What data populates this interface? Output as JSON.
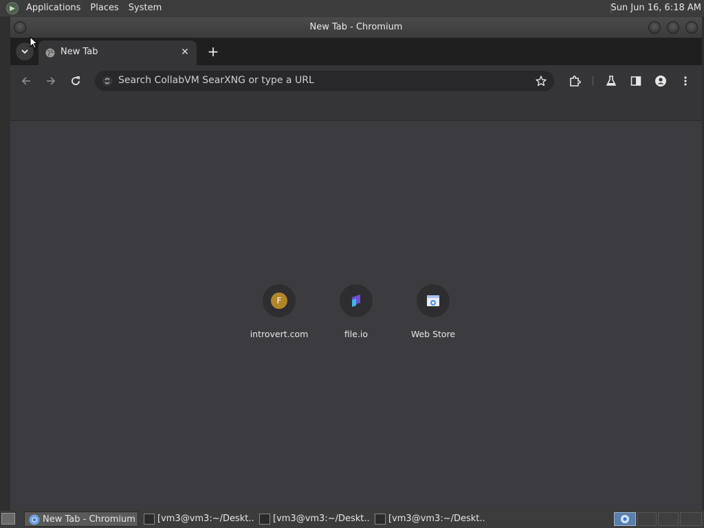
{
  "top_panel": {
    "menus": [
      "Applications",
      "Places",
      "System"
    ],
    "clock": "Sun Jun 16,  6:18 AM"
  },
  "window": {
    "title": "New Tab - Chromium"
  },
  "tabs": [
    {
      "label": "New Tab",
      "active": true
    }
  ],
  "toolbar": {
    "omnibox_placeholder": "Search CollabVM SearXNG or type a URL"
  },
  "shortcuts": [
    {
      "label": "introvert.com",
      "icon": "letter-f-favicon",
      "letter": "F"
    },
    {
      "label": "file.io",
      "icon": "fileio-favicon"
    },
    {
      "label": "Web Store",
      "icon": "webstore-favicon"
    }
  ],
  "taskbar": {
    "items": [
      {
        "label": "New Tab - Chromium",
        "active": true,
        "icon": "chromium-icon"
      },
      {
        "label": "[vm3@vm3:~/Deskt...",
        "active": false,
        "icon": "terminal-icon"
      },
      {
        "label": "[vm3@vm3:~/Deskt...",
        "active": false,
        "icon": "terminal-icon"
      },
      {
        "label": "[vm3@vm3:~/Deskt...",
        "active": false,
        "icon": "terminal-icon"
      }
    ]
  },
  "colors": {
    "panel_bg": "#3c3c3c",
    "ntp_bg": "#3c3c40",
    "toolbar_bg": "#353538",
    "tabstrip_bg": "#1f1f1f",
    "workspace_active": "#5a7fa8"
  }
}
